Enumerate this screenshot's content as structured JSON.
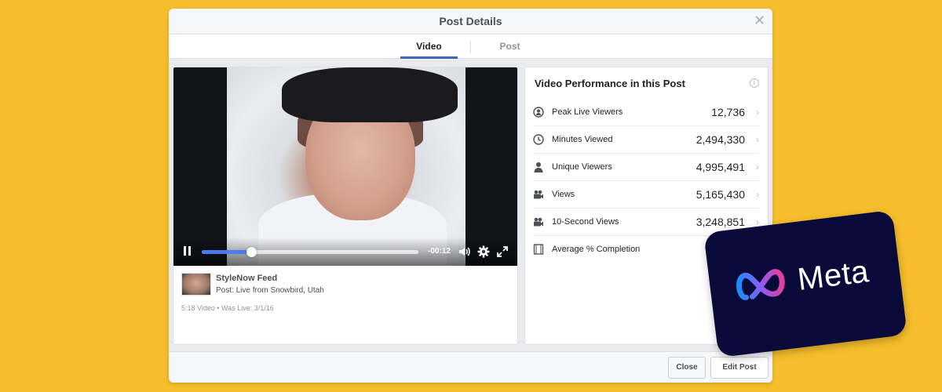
{
  "modal": {
    "title": "Post Details",
    "tabs": [
      {
        "label": "Video",
        "active": true
      },
      {
        "label": "Post",
        "active": false
      }
    ]
  },
  "video": {
    "time_remaining": "-00:12",
    "progress": 0.23,
    "feed_name": "StyleNow Feed",
    "post_description": "Post: Live from Snowbird, Utah",
    "meta_line": "5:18 Video  •  Was Live: 3/1/16"
  },
  "performance": {
    "title": "Video Performance in this Post",
    "metrics": [
      {
        "icon": "live-viewers-icon",
        "label": "Peak Live Viewers",
        "value": "12,736"
      },
      {
        "icon": "clock-icon",
        "label": "Minutes Viewed",
        "value": "2,494,330"
      },
      {
        "icon": "person-icon",
        "label": "Unique Viewers",
        "value": "4,995,491"
      },
      {
        "icon": "video-camera-icon",
        "label": "Views",
        "value": "5,165,430"
      },
      {
        "icon": "video-camera-icon",
        "label": "10-Second Views",
        "value": "3,248,851"
      },
      {
        "icon": "film-icon",
        "label": "Average % Completion",
        "value": ""
      }
    ]
  },
  "footer": {
    "close_label": "Close",
    "edit_label": "Edit Post"
  },
  "badge": {
    "brand": "Meta"
  },
  "colors": {
    "background": "#F6BE2C",
    "accent": "#4267B2",
    "badge_bg": "#0A0A3A"
  }
}
